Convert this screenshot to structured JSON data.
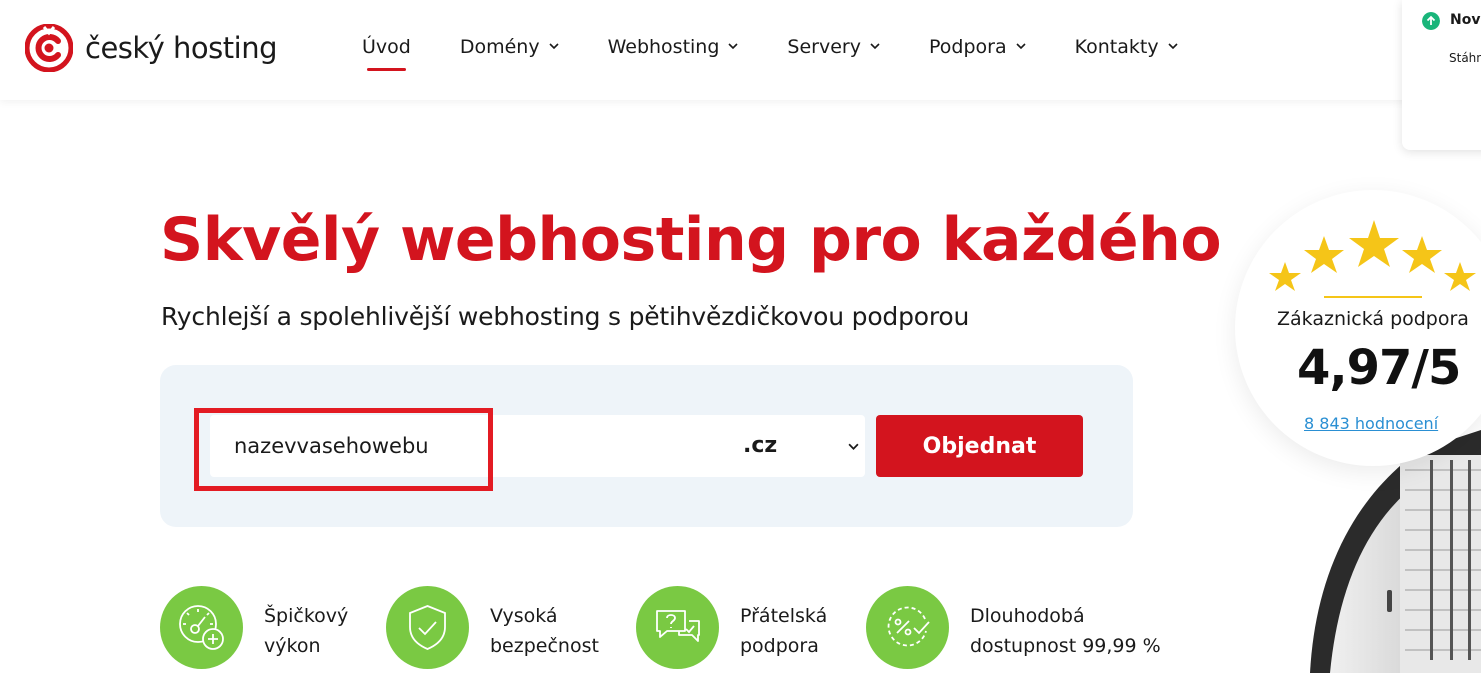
{
  "header": {
    "logo_text": "český hosting",
    "nav": [
      {
        "label": "Úvod",
        "active": true
      },
      {
        "label": "Domény",
        "dropdown": true
      },
      {
        "label": "Webhosting",
        "dropdown": true
      },
      {
        "label": "Servery",
        "dropdown": true
      },
      {
        "label": "Podpora",
        "dropdown": true
      },
      {
        "label": "Kontakty",
        "dropdown": true
      }
    ]
  },
  "notification": {
    "title": "Nova",
    "text": "Stáhn"
  },
  "hero": {
    "title": "Skvělý webhosting pro každého",
    "subtitle": "Rychlejší a spolehlivější webhosting s pětihvězdičkovou podporou"
  },
  "search": {
    "domain_value": "nazevvasehowebu",
    "tld_selected": ".cz",
    "order_label": "Objednat"
  },
  "features": [
    {
      "line1": "Špičkový",
      "line2": "výkon",
      "icon": "speedometer-plus-icon"
    },
    {
      "line1": "Vysoká",
      "line2": "bezpečnost",
      "icon": "shield-check-icon"
    },
    {
      "line1": "Přátelská",
      "line2": "podpora",
      "icon": "chat-bubbles-icon"
    },
    {
      "line1": "Dlouhodobá",
      "line2": "dostupnost 99,99 %",
      "icon": "percent-check-icon"
    }
  ],
  "rating": {
    "label": "Zákaznická podpora",
    "score": "4,97/5",
    "reviews_link": "8 843 hodnocení",
    "stars": 5
  },
  "colors": {
    "brand_red": "#d3141e",
    "feature_green": "#7ac943",
    "panel_bg": "#eef4f9",
    "star_yellow": "#f5c518",
    "link_blue": "#2a8fd3"
  }
}
